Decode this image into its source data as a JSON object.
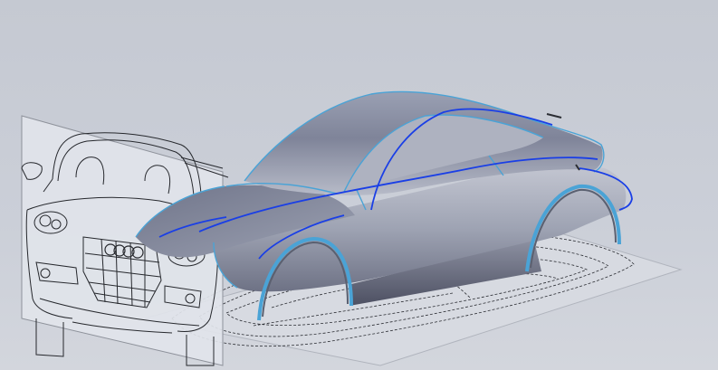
{
  "viewport": {
    "background_color": "#c7cbd4",
    "reference_plane_color": "#dde0e6",
    "body_surface_color": "#8e93a6",
    "edge_highlight_color": "#4aa3d6",
    "selected_curve_color": "#1a3fe6",
    "sketch_line_color": "#2b2d33"
  },
  "grille_badge": {
    "text": "Audi"
  }
}
